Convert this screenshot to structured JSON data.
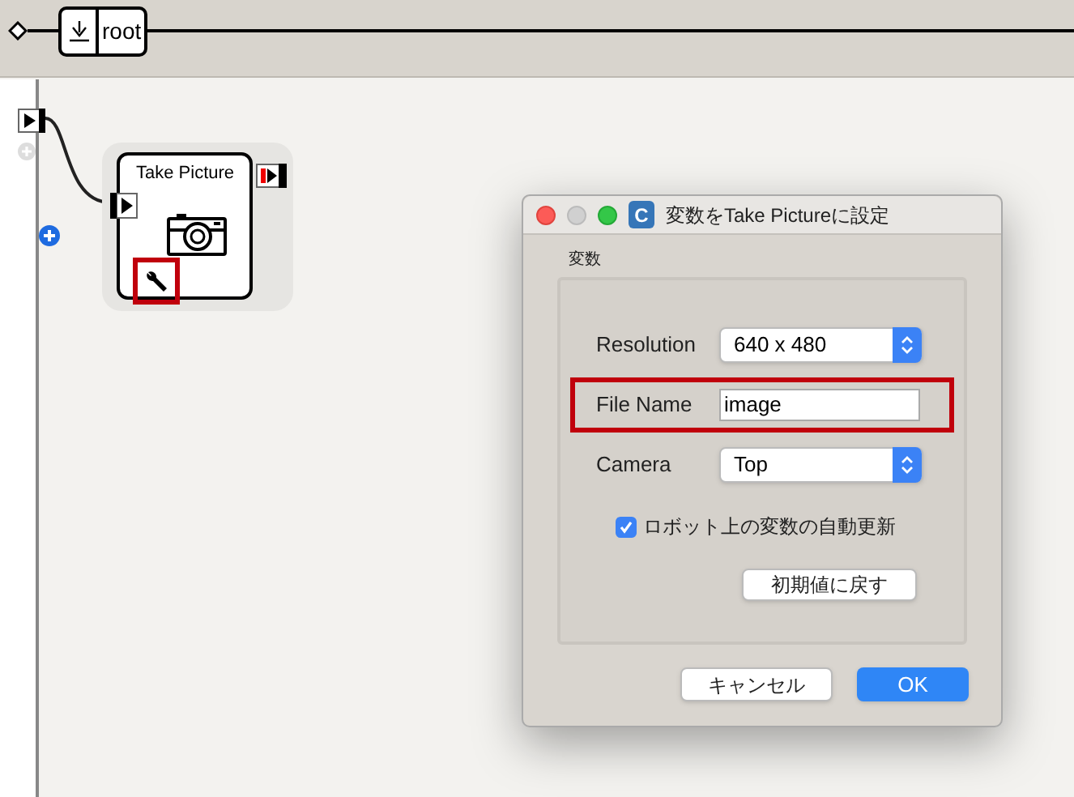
{
  "breadcrumb": {
    "label": "root"
  },
  "node": {
    "title": "Take Picture",
    "settings_highlighted": true
  },
  "dialog": {
    "title": "変数をTake Pictureに設定",
    "app_badge": "C",
    "group_label": "変数",
    "fields": [
      {
        "kind": "select",
        "label": "Resolution",
        "value": "640 x 480",
        "highlighted": false
      },
      {
        "kind": "text",
        "label": "File Name",
        "value": "image",
        "highlighted": true
      },
      {
        "kind": "select",
        "label": "Camera",
        "value": "Top",
        "highlighted": false
      }
    ],
    "checkbox": {
      "label": "ロボット上の変数の自動更新",
      "checked": true
    },
    "reset_button": "初期値に戻す",
    "cancel_button": "キャンセル",
    "ok_button": "OK"
  }
}
